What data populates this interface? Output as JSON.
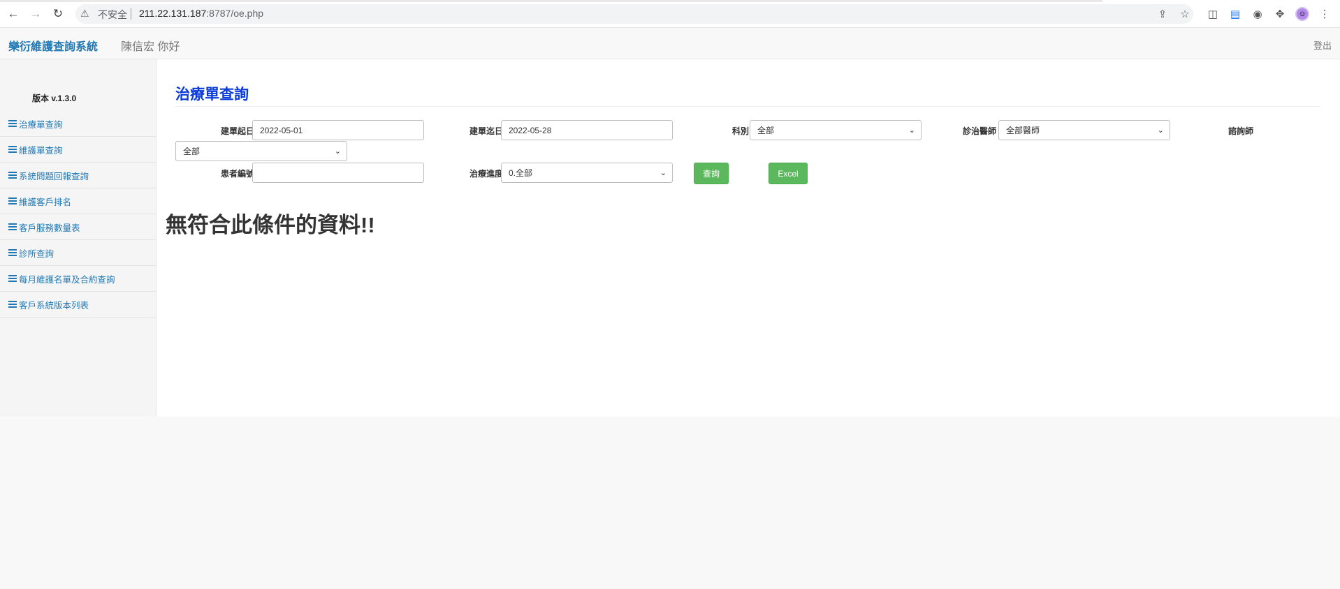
{
  "browser": {
    "insecure_label": "不安全",
    "url_host": "211.22.131.187",
    "url_rest": ":8787/oe.php"
  },
  "navbar": {
    "brand": "樂衍維護查詢系統",
    "greeting": "陳信宏 你好",
    "logout": "登出"
  },
  "sidebar": {
    "version": "版本 v.1.3.0",
    "items": [
      {
        "label": "治療單查詢"
      },
      {
        "label": "維護單查詢"
      },
      {
        "label": "系統問題回報查詢"
      },
      {
        "label": "維護客戶排名"
      },
      {
        "label": "客戶服務數量表"
      },
      {
        "label": "診所查詢"
      },
      {
        "label": "每月維護名單及合約查詢"
      },
      {
        "label": "客戶系統版本列表"
      }
    ]
  },
  "main": {
    "title": "治療單查詢",
    "form": {
      "start_date_label": "建單起日",
      "start_date_value": "2022-05-01",
      "end_date_label": "建單迄日",
      "end_date_value": "2022-05-28",
      "department_label": "科別",
      "department_value": "全部",
      "doctor_label": "診治醫師",
      "doctor_value": "全部醫師",
      "consultant_label": "諮詢師",
      "consultant_value": "全部",
      "patient_id_label": "患者編號",
      "patient_id_value": "",
      "progress_label": "治療進度",
      "progress_value": "0.全部",
      "search_button": "查詢",
      "excel_button": "Excel"
    },
    "no_data_message": "無符合此條件的資料!!"
  }
}
